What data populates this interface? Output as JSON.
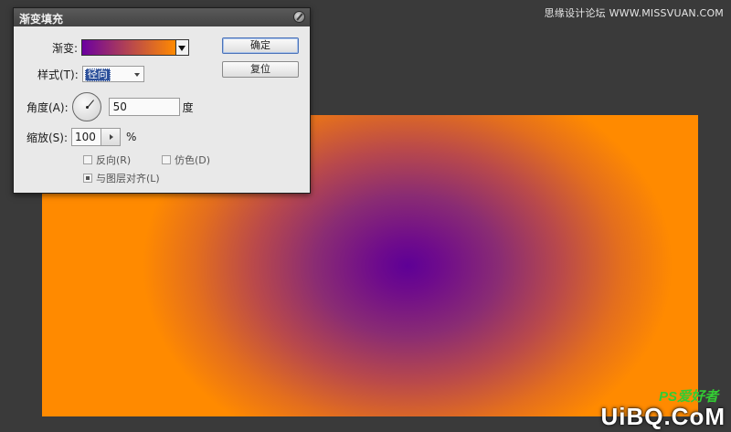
{
  "watermark": {
    "top": "思缘设计论坛 WWW.MISSVUAN.COM",
    "ps_tag": "PS爱好者",
    "url": "UiBQ.CoM"
  },
  "dialog": {
    "title": "渐变填充",
    "gradient_label": "渐变:",
    "gradient_colors": [
      "#6b00a0",
      "#ff8a00"
    ],
    "style_label": "样式(T):",
    "style_value": "径向",
    "angle_label": "角度(A):",
    "angle_value": "50",
    "angle_unit": "度",
    "scale_label": "缩放(S):",
    "scale_value": "100",
    "scale_unit": "%",
    "reverse_label": "反向(R)",
    "reverse_checked": false,
    "dither_label": "仿色(D)",
    "dither_checked": false,
    "align_label": "与图层对齐(L)",
    "align_checked": true,
    "ok_button": "确定",
    "reset_button": "复位"
  },
  "canvas": {
    "gradient_type": "radial",
    "center_color": "#5e0096",
    "edge_color": "#ff8a00"
  },
  "icons": {
    "close": "close-icon",
    "dropdown": "chevron-down-icon",
    "angle_dial": "angle-dial-icon",
    "spinner": "chevron-right-icon"
  }
}
